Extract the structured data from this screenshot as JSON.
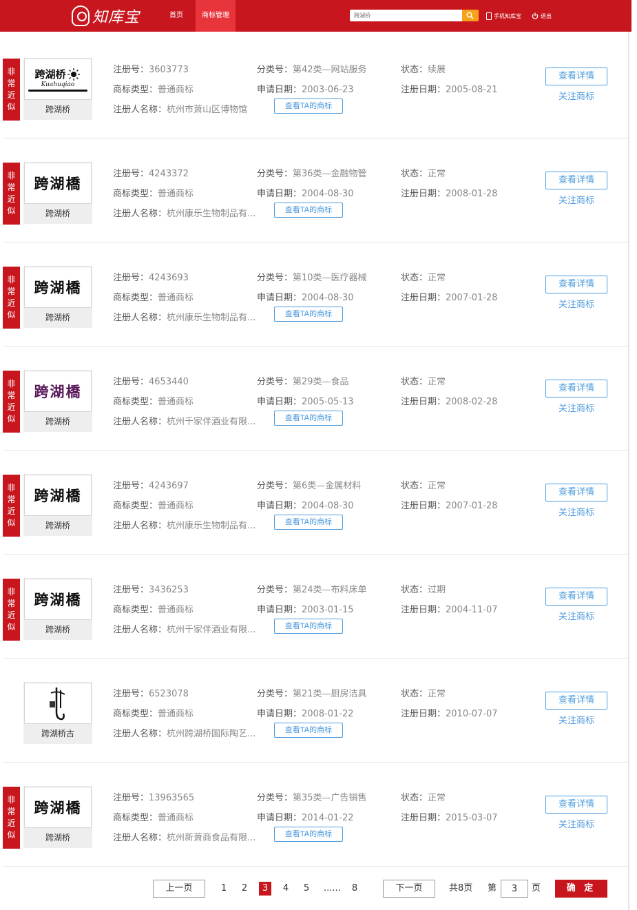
{
  "header": {
    "logo_text": "知库宝",
    "nav": [
      "首页",
      "商标管理"
    ],
    "search_placeholder": "跨湖桥",
    "mobile_label": "手机知库宝",
    "logout_label": "退出"
  },
  "labels": {
    "reg_no": "注册号：",
    "class": "分类号：",
    "status": "状态：",
    "type": "商标类型：",
    "apply_date": "申请日期：",
    "reg_date": "注册日期：",
    "owner": "注册人名称：",
    "ta_btn": "查看TA的商标",
    "detail_btn": "查看详情",
    "follow": "关注商标",
    "badge": "非常近似"
  },
  "items": [
    {
      "reg_no": "3603773",
      "class": "第42类—网站服务",
      "status": "续展",
      "type": "普通商标",
      "apply_date": "2003-06-23",
      "reg_date": "2005-08-21",
      "owner": "杭州市萧山区博物馆",
      "name": "跨湖桥",
      "logo_text": "跨湖桥",
      "logo_sub": "Kuahuqiao",
      "logo_color": "#111111",
      "badge": true
    },
    {
      "reg_no": "4243372",
      "class": "第36类—金融物管",
      "status": "正常",
      "type": "普通商标",
      "apply_date": "2004-08-30",
      "reg_date": "2008-01-28",
      "owner": "杭州康乐生物制品有...",
      "name": "跨湖桥",
      "logo_text": "跨湖橋",
      "logo_color": "#111111",
      "badge": true
    },
    {
      "reg_no": "4243693",
      "class": "第10类—医疗器械",
      "status": "正常",
      "type": "普通商标",
      "apply_date": "2004-08-30",
      "reg_date": "2007-01-28",
      "owner": "杭州康乐生物制品有...",
      "name": "跨湖桥",
      "logo_text": "跨湖橋",
      "logo_color": "#111111",
      "badge": true
    },
    {
      "reg_no": "4653440",
      "class": "第29类—食品",
      "status": "正常",
      "type": "普通商标",
      "apply_date": "2005-05-13",
      "reg_date": "2008-02-28",
      "owner": "杭州千家伴酒业有限...",
      "name": "跨湖桥",
      "logo_text": "跨湖橋",
      "logo_color": "#5a1a5a",
      "badge": true
    },
    {
      "reg_no": "4243697",
      "class": "第6类—金属材料",
      "status": "正常",
      "type": "普通商标",
      "apply_date": "2004-08-30",
      "reg_date": "2007-01-28",
      "owner": "杭州康乐生物制品有...",
      "name": "跨湖桥",
      "logo_text": "跨湖橋",
      "logo_color": "#111111",
      "badge": true
    },
    {
      "reg_no": "3436253",
      "class": "第24类—布料床单",
      "status": "过期",
      "type": "普通商标",
      "apply_date": "2003-01-15",
      "reg_date": "2004-11-07",
      "owner": "杭州千家伴酒业有限...",
      "name": "跨湖桥",
      "logo_text": "跨湖橋",
      "logo_color": "#111111",
      "badge": true
    },
    {
      "reg_no": "6523078",
      "class": "第21类—厨房洁具",
      "status": "正常",
      "type": "普通商标",
      "apply_date": "2008-01-22",
      "reg_date": "2010-07-07",
      "owner": "杭州跨湖桥国际陶艺...",
      "name": "跨湖桥古",
      "logo_text": "",
      "logo_color": "#111111",
      "badge": false
    },
    {
      "reg_no": "13963565",
      "class": "第35类—广告销售",
      "status": "正常",
      "type": "普通商标",
      "apply_date": "2014-01-22",
      "reg_date": "2015-03-07",
      "owner": "杭州新萧商食品有限...",
      "name": "跨湖桥",
      "logo_text": "跨湖橋",
      "logo_color": "#111111",
      "badge": true
    }
  ],
  "pager": {
    "prev": "上一页",
    "next": "下一页",
    "pages": [
      "1",
      "2",
      "3",
      "4",
      "5",
      "......",
      "8"
    ],
    "current": "3",
    "total_label": "共8页",
    "goto_prefix": "第",
    "goto_value": "3",
    "goto_suffix": "页",
    "confirm": "确 定"
  }
}
